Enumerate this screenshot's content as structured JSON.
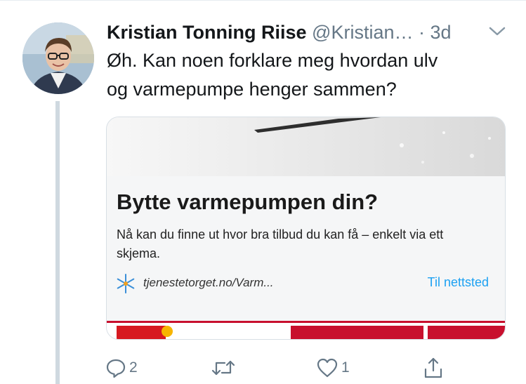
{
  "tweet": {
    "author_name": "Kristian Tonning Riise",
    "handle": "@Kristian…",
    "separator": "·",
    "time": "3d",
    "text_line1": "Øh. Kan noen forklare meg hvordan ulv",
    "text_line2": "og varmepumpe henger sammen?"
  },
  "card": {
    "title": "Bytte varmepumpen din?",
    "description": "Nå kan du finne ut hvor bra tilbud du kan få – enkelt via ett skjema.",
    "domain": "tjenestetorget.no/Varm...",
    "cta": "Til nettsted"
  },
  "actions": {
    "reply_count": "2",
    "retweet_count": "",
    "like_count": "1"
  },
  "colors": {
    "accent": "#1da1f2",
    "muted": "#657786",
    "brand_red": "#c8102e"
  },
  "icons": [
    "chevron-down-icon",
    "reply-icon",
    "retweet-icon",
    "like-icon",
    "share-icon",
    "snowflake-icon"
  ]
}
